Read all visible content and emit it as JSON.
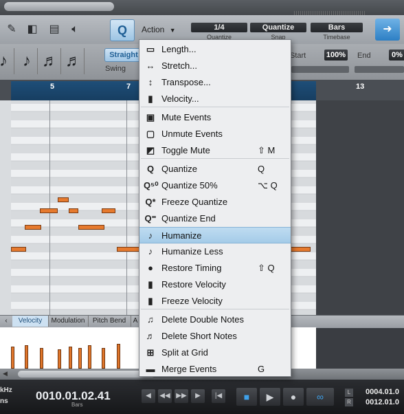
{
  "toolbar": {
    "action_label": "Action",
    "quantize_value": "1/4",
    "quantize_caption": "Quantize",
    "snap_value": "Quantize",
    "snap_caption": "Snap",
    "timebase_value": "Bars",
    "timebase_caption": "Timebase"
  },
  "groove": {
    "straight_label": "Straight",
    "swing_label": "Swing",
    "start_label": "Start",
    "start_value": "100%",
    "end_label": "End",
    "end_value": "0%"
  },
  "ruler": {
    "marks": [
      "5",
      "7",
      "13"
    ]
  },
  "lanes": {
    "tabs": [
      "Velocity",
      "Modulation",
      "Pitch Bend",
      "A"
    ]
  },
  "transport": {
    "left_line1": "kHz",
    "left_line2": "ns",
    "position": "0010.01.02.41",
    "position_unit": "Bars",
    "loop_l": "L",
    "loop_r": "R",
    "left_locator": "0004.01.0",
    "right_locator": "0012.01.0"
  },
  "menu": {
    "items": [
      {
        "label": "Length...",
        "icon": "length-icon",
        "glyph": "▭",
        "shortcut": ""
      },
      {
        "label": "Stretch...",
        "icon": "stretch-icon",
        "glyph": "↔",
        "shortcut": ""
      },
      {
        "label": "Transpose...",
        "icon": "transpose-icon",
        "glyph": "↕",
        "shortcut": ""
      },
      {
        "label": "Velocity...",
        "icon": "velocity-icon",
        "glyph": "▮",
        "shortcut": ""
      },
      {
        "label": "Mute Events",
        "icon": "mute-events-icon",
        "glyph": "▣",
        "shortcut": ""
      },
      {
        "label": "Unmute Events",
        "icon": "unmute-events-icon",
        "glyph": "▢",
        "shortcut": ""
      },
      {
        "label": "Toggle Mute",
        "icon": "toggle-mute-icon",
        "glyph": "◩",
        "shortcut": "⇧ M"
      },
      {
        "label": "Quantize",
        "icon": "quantize-icon",
        "glyph": "Q",
        "shortcut": "Q"
      },
      {
        "label": "Quantize 50%",
        "icon": "quantize-50-icon",
        "glyph": "Q⁵⁰",
        "shortcut": "⌥ Q"
      },
      {
        "label": "Freeze Quantize",
        "icon": "freeze-quantize-icon",
        "glyph": "Q*",
        "shortcut": ""
      },
      {
        "label": "Quantize End",
        "icon": "quantize-end-icon",
        "glyph": "Q⁼",
        "shortcut": ""
      },
      {
        "label": "Humanize",
        "icon": "humanize-icon",
        "glyph": "♪",
        "shortcut": ""
      },
      {
        "label": "Humanize Less",
        "icon": "humanize-less-icon",
        "glyph": "♪",
        "shortcut": ""
      },
      {
        "label": "Restore Timing",
        "icon": "restore-timing-icon",
        "glyph": "●",
        "shortcut": "⇧ Q"
      },
      {
        "label": "Restore Velocity",
        "icon": "restore-velocity-icon",
        "glyph": "▮",
        "shortcut": ""
      },
      {
        "label": "Freeze Velocity",
        "icon": "freeze-velocity-icon",
        "glyph": "▮",
        "shortcut": ""
      },
      {
        "label": "Delete Double Notes",
        "icon": "delete-double-notes-icon",
        "glyph": "♫",
        "shortcut": ""
      },
      {
        "label": "Delete Short Notes",
        "icon": "delete-short-notes-icon",
        "glyph": "♬",
        "shortcut": ""
      },
      {
        "label": "Split at Grid",
        "icon": "split-at-grid-icon",
        "glyph": "⊞",
        "shortcut": ""
      },
      {
        "label": "Merge Events",
        "icon": "merge-events-icon",
        "glyph": "▬",
        "shortcut": "G"
      }
    ],
    "highlighted": "Humanize"
  },
  "colors": {
    "accent_blue": "#2c7fc4",
    "note_orange": "#e67a2e",
    "menu_highlight": "#a4cbe8"
  }
}
